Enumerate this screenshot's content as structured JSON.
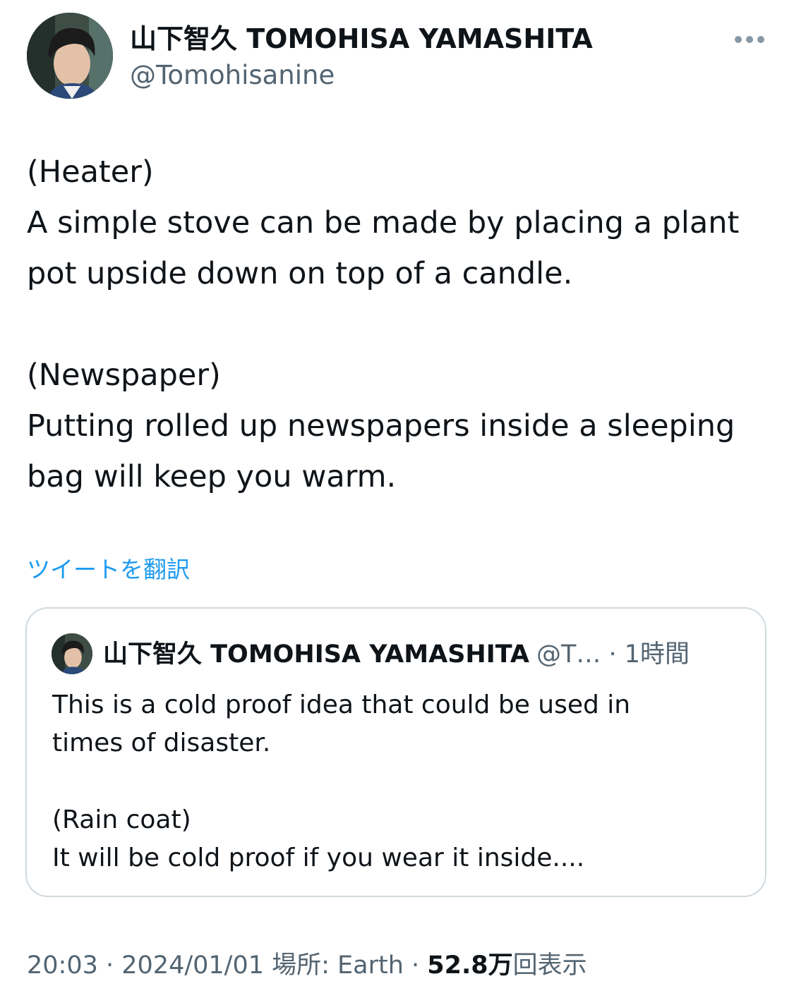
{
  "author": {
    "display_name": "山下智久 TOMOHISA YAMASHITA",
    "handle": "@Tomohisanine",
    "avatar_icon": "profile-photo"
  },
  "more_icon": "more-horizontal-icon",
  "tweet": {
    "lines": [
      "(Heater)",
      "A simple stove can be made by placing a plant",
      "pot upside down on top of a candle.",
      "",
      "(Newspaper)",
      "Putting rolled up newspapers inside a sleeping",
      "bag will keep you warm."
    ],
    "translate_label": "ツイートを翻訳"
  },
  "quoted_tweet": {
    "display_name": "山下智久 TOMOHISA YAMASHITA",
    "meta": "@T… · 1時間",
    "lines": [
      "This is a cold proof idea that could be used in",
      "times of disaster.",
      "",
      "(Rain coat)",
      "It will be cold proof if you wear it inside...."
    ]
  },
  "footer": {
    "time": "20:03",
    "separator": " · ",
    "date": "2024/01/01",
    "location": " 場所: Earth",
    "separator2": " · ",
    "views_count": "52.8万",
    "views_label": "回表示"
  },
  "colors": {
    "text_primary": "#0f1419",
    "text_secondary": "#536471",
    "link": "#1d9bf0",
    "border": "#cfd9de"
  }
}
